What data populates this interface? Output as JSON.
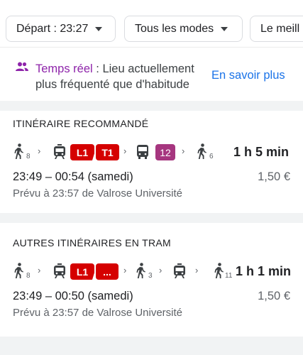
{
  "filters": {
    "departure_label": "Départ : 23:27",
    "modes_label": "Tous les modes",
    "best_label": "Le meill"
  },
  "banner": {
    "realtime_label": "Temps réel",
    "message": " : Lieu actuellement plus fréquenté que d'habitude",
    "learn_more": "En savoir plus",
    "accent_color": "#8e24aa"
  },
  "recommended": {
    "section_title": "ITINÉRAIRE RECOMMANDÉ",
    "steps": {
      "walk1_minutes": "8",
      "tram_line_1": "L1",
      "tram_line_2": "T1",
      "bus_line": "12",
      "walk2_minutes": "6"
    },
    "duration": "1 h 5 min",
    "times": "23:49 – 00:54 (samedi)",
    "price": "1,50 €",
    "planned": "Prévu à 23:57 de Valrose Université"
  },
  "tram": {
    "section_title": "AUTRES ITINÉRAIRES EN TRAM",
    "steps": {
      "walk1_minutes": "8",
      "tram_line_1": "L1",
      "tram_line_more": "...",
      "walk2_minutes": "3",
      "walk3_minutes": "11"
    },
    "duration": "1 h 1 min",
    "times": "23:49 – 00:50 (samedi)",
    "price": "1,50 €",
    "planned": "Prévu à 23:57 de Valrose Université"
  }
}
